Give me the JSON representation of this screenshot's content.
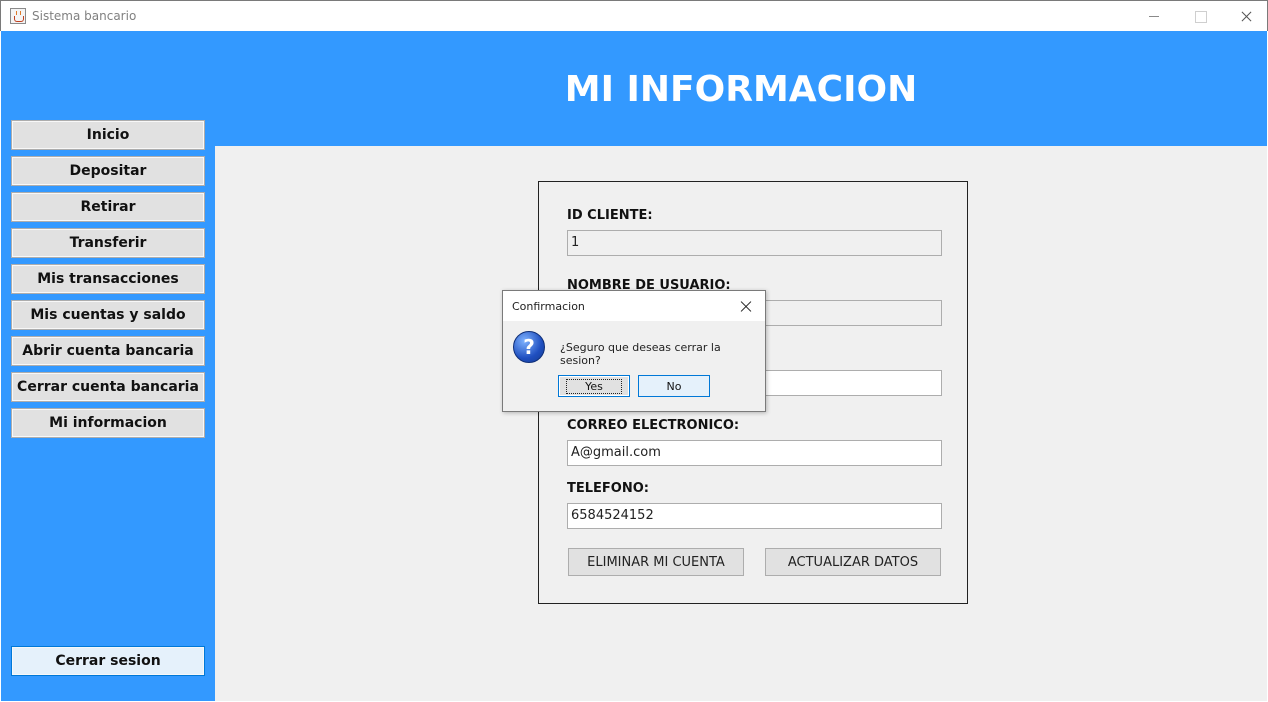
{
  "window": {
    "title": "Sistema bancario"
  },
  "header": {
    "title": "MI INFORMACION"
  },
  "sidebar": {
    "items": [
      {
        "label": "Inicio"
      },
      {
        "label": "Depositar"
      },
      {
        "label": "Retirar"
      },
      {
        "label": "Transferir"
      },
      {
        "label": "Mis transacciones"
      },
      {
        "label": "Mis cuentas y saldo"
      },
      {
        "label": "Abrir cuenta bancaria"
      },
      {
        "label": "Cerrar cuenta bancaria"
      },
      {
        "label": "Mi informacion"
      }
    ],
    "logout_label": "Cerrar sesion"
  },
  "form": {
    "id_label": "ID CLIENTE:",
    "id_value": "1",
    "username_label": "NOMBRE DE USUARIO:",
    "username_value": "",
    "third_value": "",
    "email_label": "CORREO ELECTRONICO:",
    "email_value": "A@gmail.com",
    "phone_label": "TELEFONO:",
    "phone_value": "6584524152",
    "delete_button": "ELIMINAR MI CUENTA",
    "update_button": "ACTUALIZAR DATOS"
  },
  "dialog": {
    "title": "Confirmacion",
    "message": "¿Seguro que deseas cerrar la sesion?",
    "yes_label": "Yes",
    "no_label": "No",
    "icon": "question-icon"
  },
  "colors": {
    "accent": "#3399ff",
    "content_bg": "#f0f0f0"
  }
}
